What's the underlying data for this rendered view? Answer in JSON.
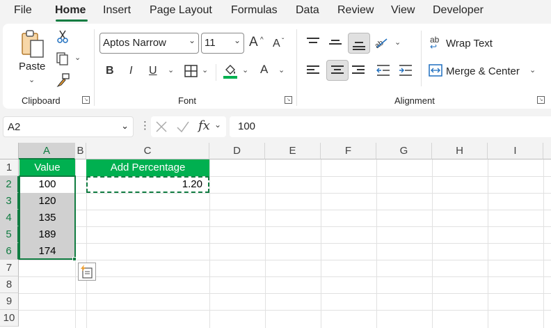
{
  "menu": {
    "items": [
      "File",
      "Home",
      "Insert",
      "Page Layout",
      "Formulas",
      "Data",
      "Review",
      "View",
      "Developer"
    ],
    "active": "Home"
  },
  "ribbon": {
    "clipboard": {
      "label": "Clipboard",
      "paste": "Paste"
    },
    "font": {
      "label": "Font",
      "font_name": "Aptos Narrow",
      "font_size": "11",
      "grow": "A",
      "shrink": "A",
      "bold": "B",
      "italic": "I",
      "underline": "U",
      "font_color": "A"
    },
    "alignment": {
      "label": "Alignment",
      "wrap_text": "Wrap Text",
      "merge_center": "Merge & Center",
      "wrap_icon_text": "ab"
    }
  },
  "formula_bar": {
    "name_box": "A2",
    "fx": "fx",
    "value": "100"
  },
  "grid": {
    "columns": [
      "A",
      "B",
      "C",
      "D",
      "E",
      "F",
      "G",
      "H",
      "I"
    ],
    "rows": [
      "1",
      "2",
      "3",
      "4",
      "5",
      "6",
      "7",
      "8",
      "9",
      "10"
    ],
    "selected_column": "A",
    "cells": {
      "A1": "Value",
      "A2": "100",
      "A3": "120",
      "A4": "135",
      "A5": "189",
      "A6": "174",
      "C1": "Add Percentage",
      "C2": "1.20"
    }
  },
  "colors": {
    "accent": "#107c41",
    "header_fill": "#00b050",
    "selection_fill": "#d0d0d0"
  }
}
